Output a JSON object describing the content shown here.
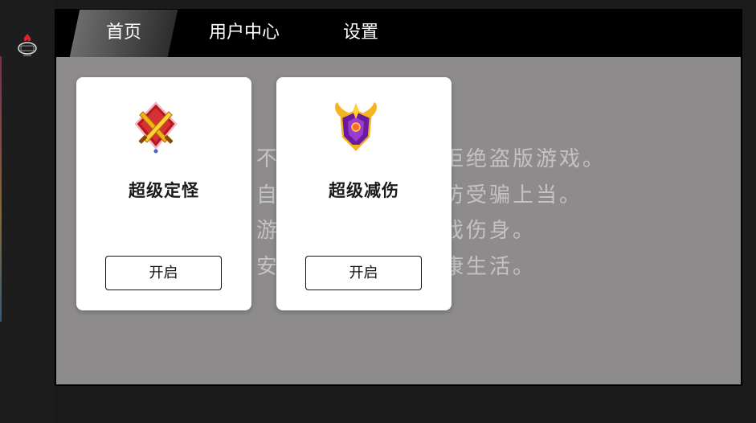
{
  "tabs": [
    {
      "label": "首页",
      "active": true
    },
    {
      "label": "用户中心",
      "active": false
    },
    {
      "label": "设置",
      "active": false
    }
  ],
  "notice_lines": [
    "不抵制不良游戏，拒绝盗版游戏。",
    "自我保护意识，谨防受骗上当。",
    "游戏益脑，沉迷游戏伤身。",
    "安排时间，享受健康生活。"
  ],
  "cards": [
    {
      "title": "超级定怪",
      "button_label": "开启",
      "icon": "crossed-swords-icon"
    },
    {
      "title": "超级减伤",
      "button_label": "开启",
      "icon": "winged-shield-icon"
    }
  ],
  "colors": {
    "content_bg": "#8d8b8c",
    "tabbar_bg": "#000000",
    "card_bg": "#ffffff",
    "notice_text": "#c4c2c3"
  }
}
